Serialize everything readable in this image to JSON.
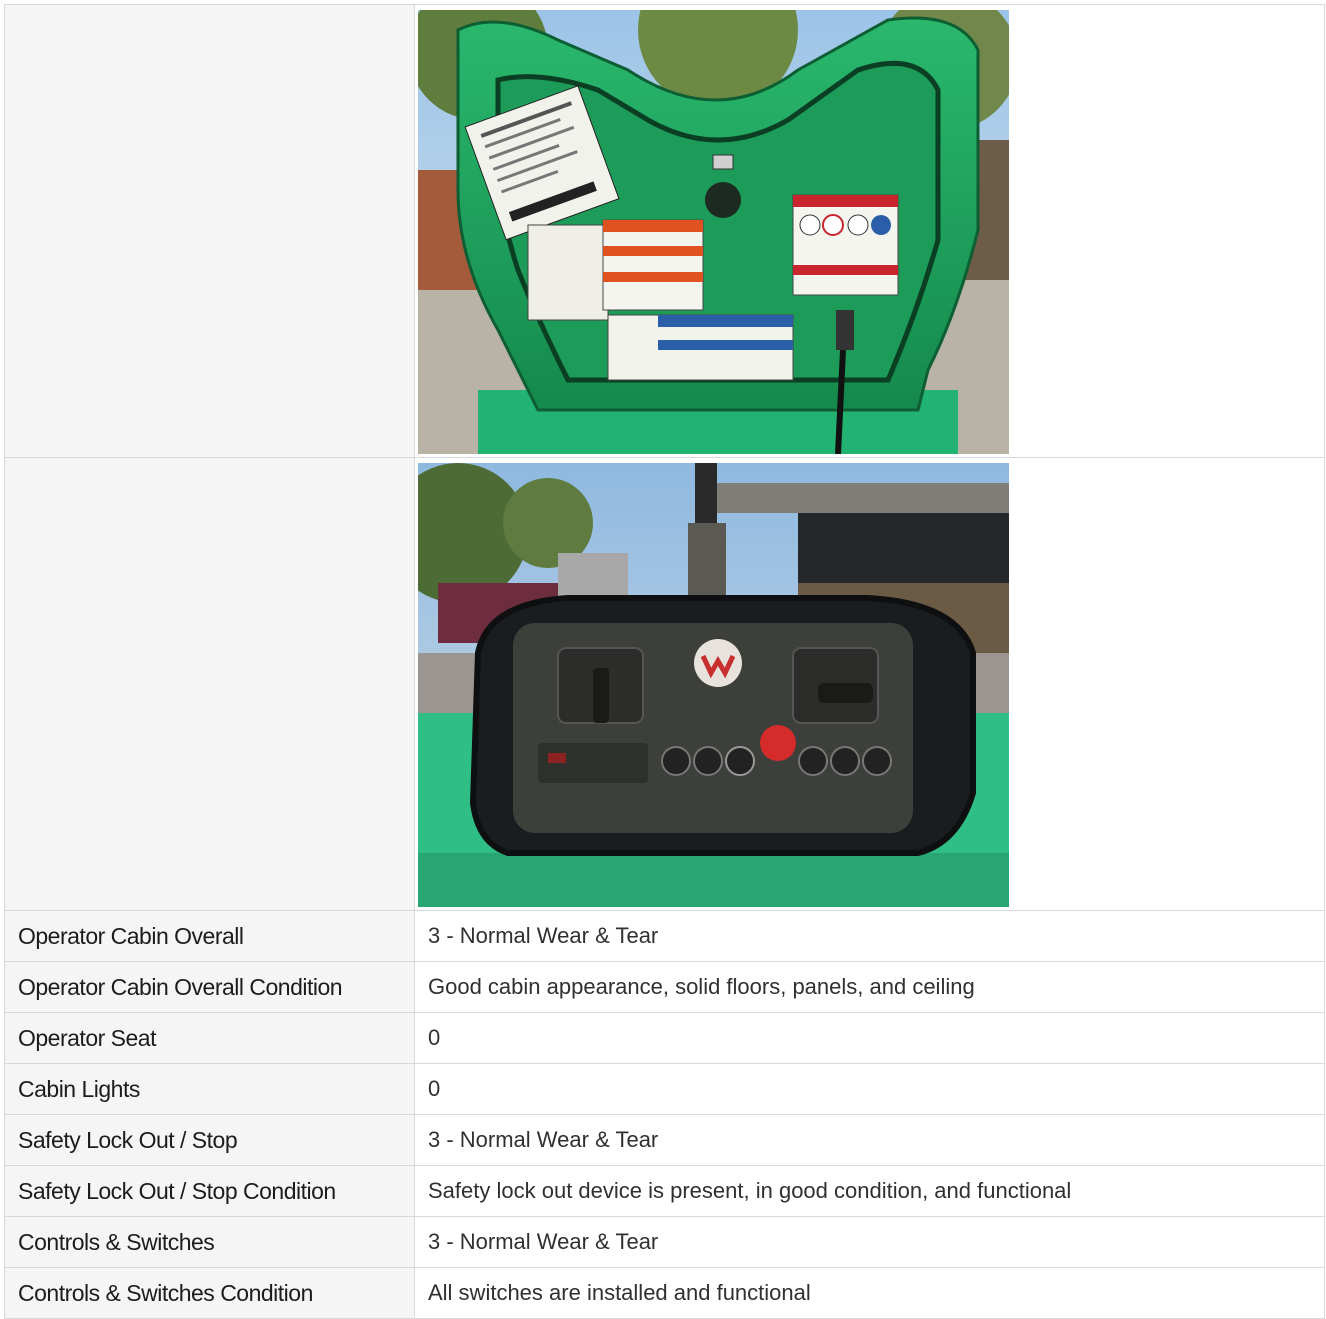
{
  "photos": [
    {
      "icon": "equipment-handle-decals-photo"
    },
    {
      "icon": "remote-control-panel-photo"
    }
  ],
  "rows": [
    {
      "label": "Operator Cabin Overall",
      "value": "3 - Normal Wear & Tear"
    },
    {
      "label": "Operator Cabin Overall Condition",
      "value": "Good cabin appearance, solid floors, panels, and ceiling"
    },
    {
      "label": "Operator Seat",
      "value": "0"
    },
    {
      "label": "Cabin Lights",
      "value": "0"
    },
    {
      "label": "Safety Lock Out / Stop",
      "value": "3 - Normal Wear & Tear"
    },
    {
      "label": "Safety Lock Out / Stop Condition",
      "value": "Safety lock out device is present, in good condition, and functional"
    },
    {
      "label": "Controls & Switches",
      "value": "3 - Normal Wear & Tear"
    },
    {
      "label": "Controls & Switches Condition",
      "value": "All switches are installed and functional"
    }
  ],
  "colors": {
    "label_bg": "#f5f5f5",
    "border": "#d9d9d9",
    "equipment_green": "#1fb36a"
  }
}
